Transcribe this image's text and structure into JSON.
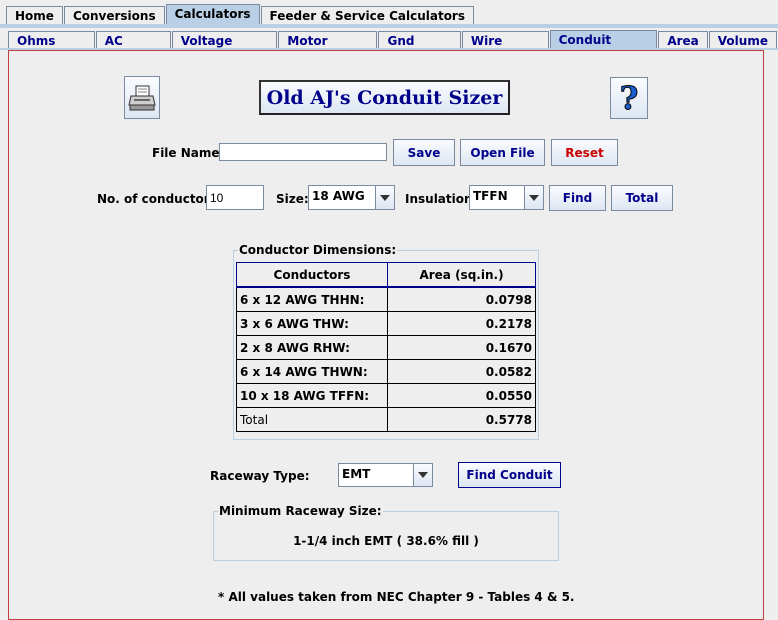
{
  "top_tabs": [
    "Home",
    "Conversions",
    "Calculators",
    "Feeder & Service Calculators"
  ],
  "sub_tabs": [
    "Ohms Law",
    "AC Calcs",
    "Voltage Drop",
    "Motor Amps",
    "Gnd Sizer",
    "Wire Sizer",
    "Conduit Sizer",
    "Area",
    "Volume"
  ],
  "title": "Old AJ's Conduit Sizer",
  "help_glyph": "?",
  "file": {
    "label": "File Name:",
    "value": "",
    "save": "Save",
    "open": "Open File",
    "reset": "Reset"
  },
  "conductors": {
    "count_label": "No. of conductors:",
    "count_value": "10",
    "size_label": "Size:",
    "size_value": "18 AWG",
    "insulation_label": "Insulation:",
    "insulation_value": "TFFN",
    "find": "Find",
    "total": "Total"
  },
  "dimensions": {
    "group_title": "Conductor Dimensions:",
    "headers": [
      "Conductors",
      "Area (sq.in.)"
    ],
    "rows": [
      {
        "conductor": " 6 x 12 AWG THHN:",
        "area": "0.0798"
      },
      {
        "conductor": "3 x 6 AWG THW:",
        "area": "0.2178"
      },
      {
        "conductor": "2 x 8 AWG RHW:",
        "area": "0.1670"
      },
      {
        "conductor": "6 x 14 AWG THWN:",
        "area": "0.0582"
      },
      {
        "conductor": "10 x 18 AWG TFFN:",
        "area": "0.0550"
      }
    ],
    "total_label": "Total",
    "total_value": "0.5778"
  },
  "raceway": {
    "label": "Raceway Type:",
    "value": "EMT",
    "find": "Find Conduit"
  },
  "minimum": {
    "group_title": "Minimum Raceway Size:",
    "result": "1-1/4 inch EMT ( 38.6% fill )"
  },
  "footnote": "* All values taken from NEC Chapter 9 - Tables 4 & 5.",
  "colors": {
    "accent": "#00008b",
    "reset": "#cc0000",
    "tab_selected": "#b8cfe5",
    "panel_border": "#c04040"
  }
}
